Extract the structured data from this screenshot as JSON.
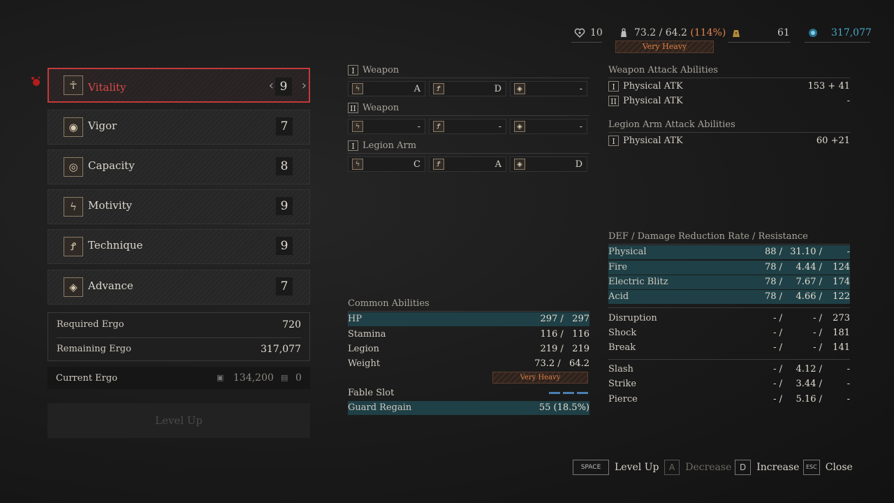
{
  "topbar": {
    "heart_count": "10",
    "weight_current": "73.2 / 64.2",
    "weight_pct": "(114%)",
    "weight_status": "Very Heavy",
    "item_count": "61",
    "ergo_total": "317,077"
  },
  "attributes": [
    {
      "name": "Vitality",
      "value": "9",
      "icon": "vitruvian-icon",
      "glyph": "☥"
    },
    {
      "name": "Vigor",
      "value": "7",
      "icon": "vigor-ring-icon",
      "glyph": "◉"
    },
    {
      "name": "Capacity",
      "value": "8",
      "icon": "eye-icon",
      "glyph": "◎"
    },
    {
      "name": "Motivity",
      "value": "9",
      "icon": "lightning-icon",
      "glyph": "ϟ"
    },
    {
      "name": "Technique",
      "value": "9",
      "icon": "technique-icon",
      "glyph": "Ꝭ"
    },
    {
      "name": "Advance",
      "value": "7",
      "icon": "diamond-icon",
      "glyph": "◈"
    }
  ],
  "ergo": {
    "required_label": "Required Ergo",
    "required_value": "720",
    "remaining_label": "Remaining Ergo",
    "remaining_value": "317,077",
    "current_label": "Current Ergo",
    "current_value": "134,200",
    "current_extra": "0",
    "level_up_label": "Level Up"
  },
  "weapons": [
    {
      "roman": "I",
      "label": "Weapon",
      "grades": [
        "A",
        "D",
        "-"
      ]
    },
    {
      "roman": "II",
      "label": "Weapon",
      "grades": [
        "-",
        "-",
        "-"
      ]
    },
    {
      "roman": "I",
      "label": "Legion Arm",
      "grades": [
        "C",
        "A",
        "D"
      ]
    }
  ],
  "common": {
    "title": "Common Abilities",
    "rows": [
      {
        "label": "HP",
        "value": "297 /   297"
      },
      {
        "label": "Stamina",
        "value": "116 /   116"
      },
      {
        "label": "Legion",
        "value": "219 /   219"
      },
      {
        "label": "Weight",
        "value": "73.2 /   64.2"
      }
    ],
    "weight_status": "Very Heavy",
    "fable_label": "Fable Slot",
    "guard_label": "Guard Regain",
    "guard_value": "55 (18.5%)"
  },
  "weapon_attack": {
    "title": "Weapon Attack Abilities",
    "rows": [
      {
        "roman": "I",
        "label": "Physical ATK",
        "value": "153 + 41"
      },
      {
        "roman": "II",
        "label": "Physical ATK",
        "value": "-"
      }
    ]
  },
  "legion_attack": {
    "title": "Legion Arm Attack Abilities",
    "rows": [
      {
        "roman": "I",
        "label": "Physical ATK",
        "value": "60 +21"
      }
    ]
  },
  "defense": {
    "title": "DEF / Damage Reduction Rate / Resistance",
    "group1": [
      {
        "label": "Physical",
        "c1": "88 /",
        "c2": "31.10 /",
        "c3": "-"
      },
      {
        "label": "Fire",
        "c1": "78 /",
        "c2": "4.44 /",
        "c3": "124"
      },
      {
        "label": "Electric Blitz",
        "c1": "78 /",
        "c2": "7.67 /",
        "c3": "174"
      },
      {
        "label": "Acid",
        "c1": "78 /",
        "c2": "4.66 /",
        "c3": "122"
      }
    ],
    "group2": [
      {
        "label": "Disruption",
        "c1": "- /",
        "c2": "- /",
        "c3": "273"
      },
      {
        "label": "Shock",
        "c1": "- /",
        "c2": "- /",
        "c3": "181"
      },
      {
        "label": "Break",
        "c1": "- /",
        "c2": "- /",
        "c3": "141"
      }
    ],
    "group3": [
      {
        "label": "Slash",
        "c1": "- /",
        "c2": "4.12 /",
        "c3": "-"
      },
      {
        "label": "Strike",
        "c1": "- /",
        "c2": "3.44 /",
        "c3": "-"
      },
      {
        "label": "Pierce",
        "c1": "- /",
        "c2": "5.16 /",
        "c3": "-"
      }
    ]
  },
  "footer": {
    "space_key": "SPACE",
    "level_up": "Level Up",
    "a_key": "A",
    "decrease": "Decrease",
    "d_key": "D",
    "increase": "Increase",
    "esc_key": "ESC",
    "close": "Close"
  },
  "colors": {
    "selected_border": "#c23a3a",
    "highlight_row": "#1f4046",
    "warning_orange": "#e0824d",
    "ergo_cyan": "#4aa9c7"
  }
}
